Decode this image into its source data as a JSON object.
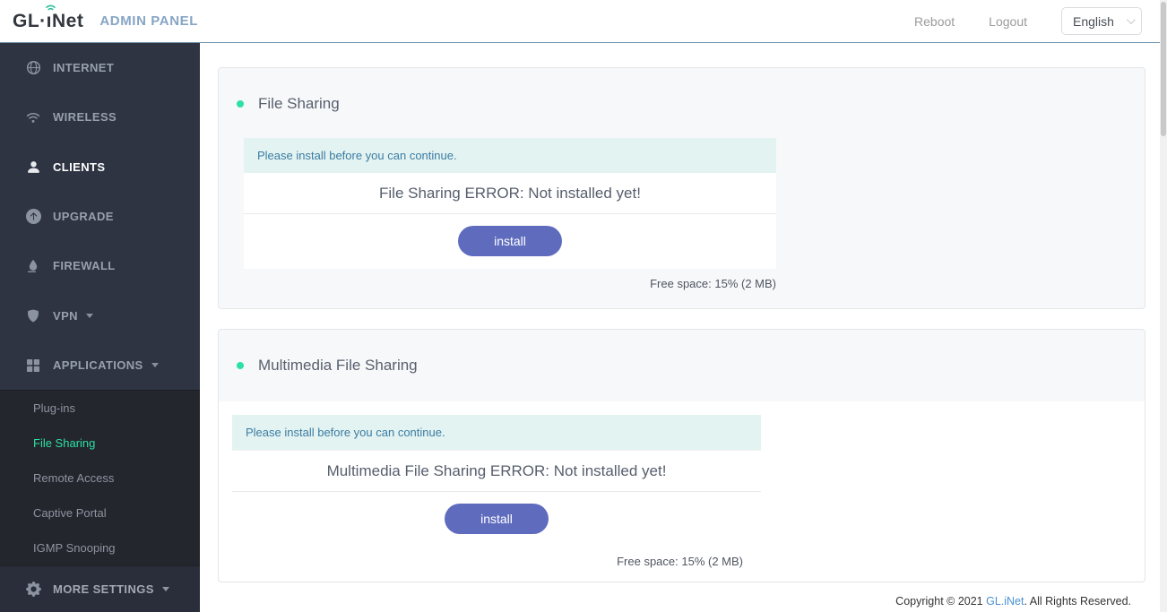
{
  "header": {
    "logo": {
      "prefix": "GL·",
      "i_char": "ı",
      "suffix": "Net",
      "subtitle": "ADMIN PANEL"
    },
    "reboot_label": "Reboot",
    "logout_label": "Logout",
    "language": "English"
  },
  "sidebar": {
    "items": [
      {
        "label": "INTERNET",
        "icon": "globe-icon"
      },
      {
        "label": "WIRELESS",
        "icon": "wifi-icon"
      },
      {
        "label": "CLIENTS",
        "icon": "user-icon",
        "active": true
      },
      {
        "label": "UPGRADE",
        "icon": "upgrade-icon"
      },
      {
        "label": "FIREWALL",
        "icon": "firewall-icon"
      },
      {
        "label": "VPN",
        "icon": "shield-icon",
        "caret": true
      },
      {
        "label": "APPLICATIONS",
        "icon": "grid-icon",
        "caret": true,
        "expanded": true
      }
    ],
    "submenu": [
      {
        "label": "Plug-ins"
      },
      {
        "label": "File Sharing",
        "active": true
      },
      {
        "label": "Remote Access"
      },
      {
        "label": "Captive Portal"
      },
      {
        "label": "IGMP Snooping"
      }
    ],
    "more_settings_label": "MORE SETTINGS"
  },
  "cards": [
    {
      "title": "File Sharing",
      "banner": "Please install before you can continue.",
      "error": "File Sharing ERROR: Not installed yet!",
      "install_label": "install",
      "free_space": "Free space: 15% (2 MB)"
    },
    {
      "title": "Multimedia File Sharing",
      "banner": "Please install before you can continue.",
      "error": "Multimedia File Sharing ERROR: Not installed yet!",
      "install_label": "install",
      "free_space": "Free space: 15% (2 MB)"
    }
  ],
  "footer": {
    "prefix": "Copyright © 2021 ",
    "brand_link": "GL.iNet",
    "suffix": ". All Rights Reserved."
  },
  "colors": {
    "accent_green": "#2de0a4",
    "sidebar_active_green": "#2be0a0",
    "install_button": "#5f6cbe",
    "banner_bg": "#e3f3f1",
    "banner_text": "#3b7ca3",
    "sidebar_bg": "#2e3442",
    "submenu_bg": "#24262d",
    "header_border": "#7493ae",
    "admin_panel_text": "#87a5c5",
    "footer_link": "#4a90d2"
  }
}
